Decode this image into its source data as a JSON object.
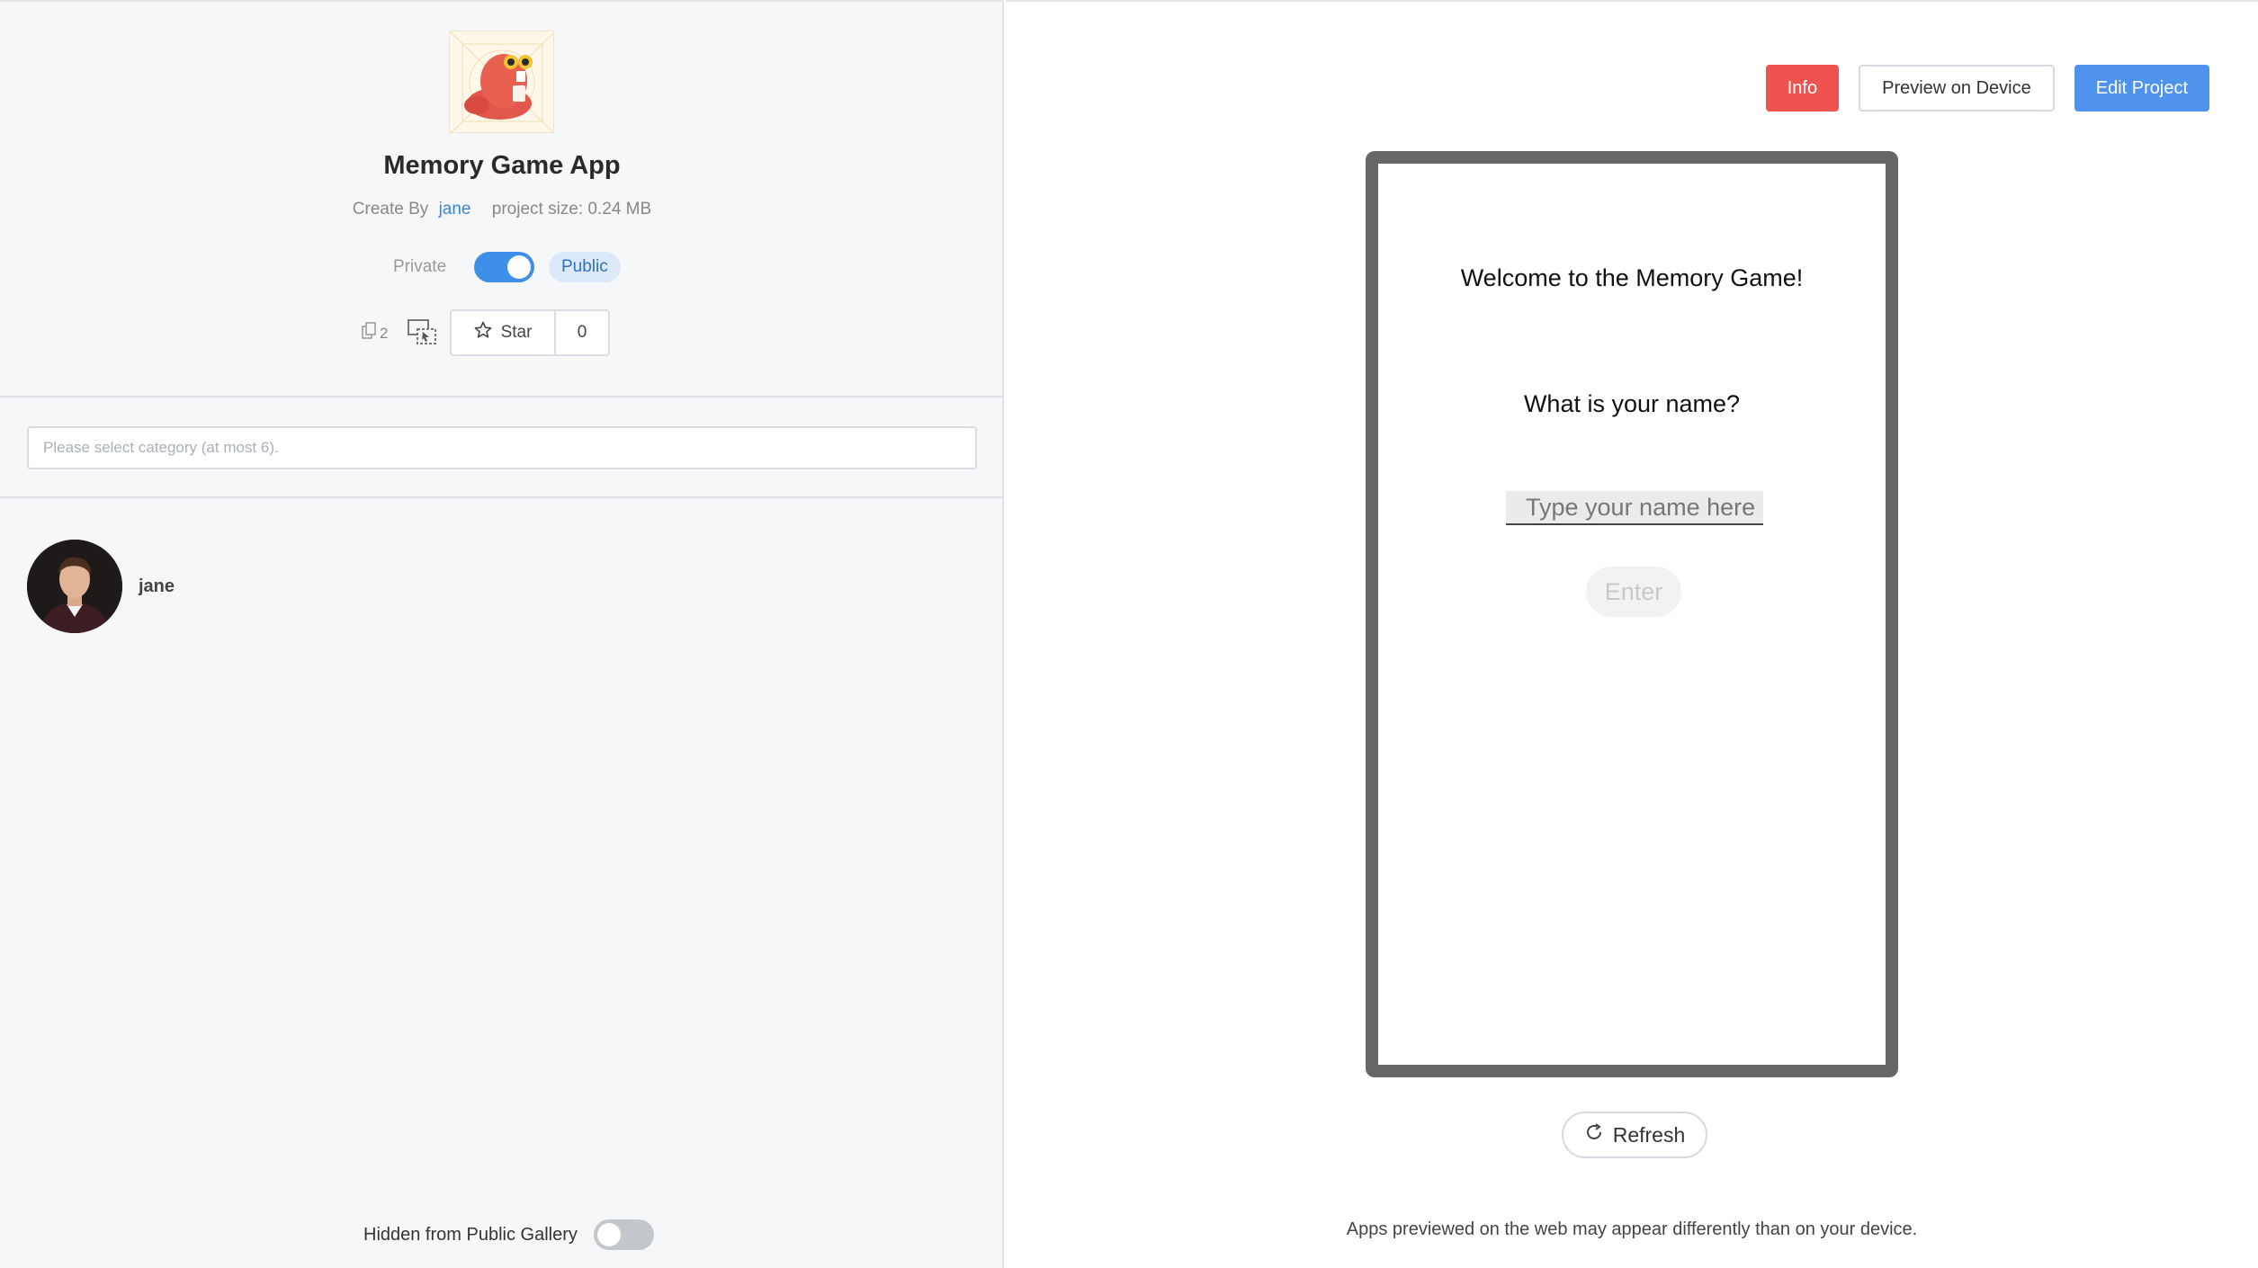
{
  "project": {
    "title": "Memory Game App",
    "created_by_label": "Create By",
    "author": "jane",
    "size_label": "project size: 0.24 MB"
  },
  "visibility": {
    "private_label": "Private",
    "public_label": "Public",
    "is_public": true
  },
  "actions": {
    "duplicate_count": "2",
    "star_label": "Star",
    "star_count": "0"
  },
  "category": {
    "placeholder": "Please select category (at most 6)."
  },
  "collaborators": [
    {
      "name": "jane"
    }
  ],
  "gallery": {
    "hidden_label": "Hidden from Public Gallery",
    "hidden": false
  },
  "toolbar": {
    "info_label": "Info",
    "preview_label": "Preview on Device",
    "edit_label": "Edit Project"
  },
  "preview_screen": {
    "welcome": "Welcome to the Memory Game!",
    "question": "What is your name?",
    "name_placeholder": "Type your name here",
    "enter_label": "Enter"
  },
  "refresh_label": "Refresh",
  "preview_note": "Apps previewed on the web may appear differently than on your device.",
  "colors": {
    "accent_blue": "#3d8fe8",
    "info_red": "#ef5350",
    "edit_blue": "#4f93ef"
  }
}
